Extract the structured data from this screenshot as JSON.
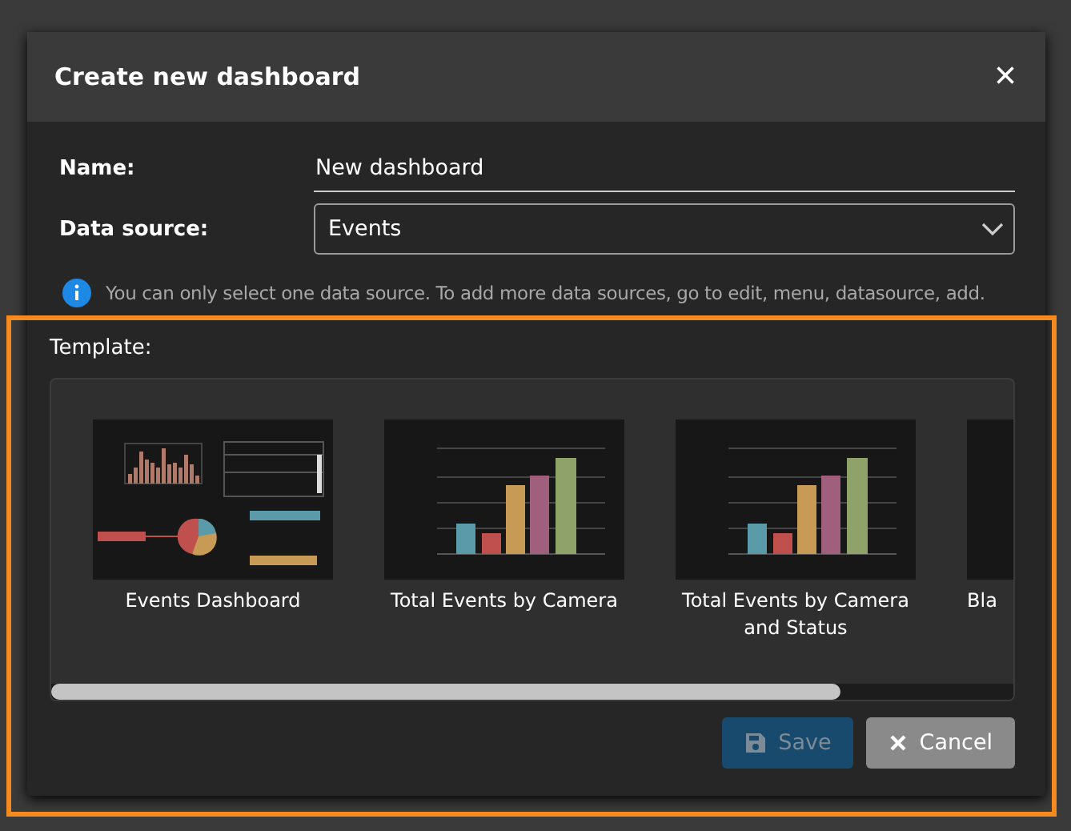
{
  "dialog": {
    "title": "Create new dashboard",
    "close": "×"
  },
  "fields": [
    {
      "kind": "text",
      "label": "Name:",
      "value": "New dashboard"
    },
    {
      "kind": "select",
      "label": "Data source:",
      "value": "Events"
    }
  ],
  "info": "You can only select one data source. To add more data sources, go to edit, menu, datasource, add.",
  "template": {
    "label": "Template:",
    "items": [
      {
        "kind": "dashboard",
        "name": "Events Dashboard"
      },
      {
        "kind": "bars",
        "name": "Total Events by Camera"
      },
      {
        "kind": "bars",
        "name": "Total Events by Camera and Status"
      },
      {
        "kind": "blank",
        "name": "Bla"
      }
    ]
  },
  "buttons": [
    {
      "kind": "save",
      "label": "Save",
      "disabled": true
    },
    {
      "kind": "cancel",
      "label": "Cancel",
      "disabled": false
    }
  ],
  "highlight": true
}
